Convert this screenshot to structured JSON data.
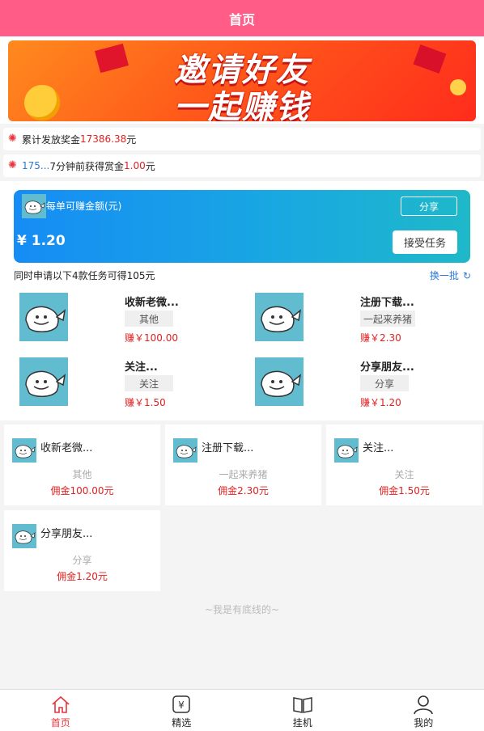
{
  "header": {
    "title": "首页"
  },
  "banner": {
    "line1": "邀请好友",
    "line2": "一起赚钱"
  },
  "notices": [
    {
      "prefix": "累计发放奖金 ",
      "highlight": "17386.38",
      "suffix": " 元"
    },
    {
      "user": "175...",
      "middle": "7分钟前获得赏金",
      "amount": "1.00",
      "suffix": " 元"
    }
  ],
  "reward_card": {
    "title": "每单可赚金额(元)",
    "amount": "¥ 1.20",
    "share_label": "分享",
    "accept_label": "接受任务"
  },
  "hint": {
    "text": "同时申请以下4款任务可得105元",
    "refresh_label": "换一批"
  },
  "tasks_top": [
    {
      "name": "收新老微...",
      "tag": "其他",
      "earn": "赚￥100.00"
    },
    {
      "name": "注册下载...",
      "tag": "一起来养猪",
      "earn": "赚￥2.30"
    },
    {
      "name": "关注...",
      "tag": "关注",
      "earn": "赚￥1.50"
    },
    {
      "name": "分享朋友...",
      "tag": "分享",
      "earn": "赚￥1.20"
    }
  ],
  "tasks_cards": [
    {
      "name": "收新老微...",
      "tag": "其他",
      "commission": "佣金100.00元"
    },
    {
      "name": "注册下载...",
      "tag": "一起来养猪",
      "commission": "佣金2.30元"
    },
    {
      "name": "关注...",
      "tag": "关注",
      "commission": "佣金1.50元"
    },
    {
      "name": "分享朋友...",
      "tag": "分享",
      "commission": "佣金1.20元"
    }
  ],
  "footer_text": "~我是有底线的~",
  "tabbar": [
    {
      "label": "首页",
      "icon": "home-icon",
      "active": true
    },
    {
      "label": "精选",
      "icon": "yen-icon",
      "active": false
    },
    {
      "label": "挂机",
      "icon": "book-icon",
      "active": false
    },
    {
      "label": "我的",
      "icon": "user-icon",
      "active": false
    }
  ],
  "colors": {
    "header": "#ff5c87",
    "accent_red": "#e02020",
    "link_blue": "#2a78d8"
  }
}
